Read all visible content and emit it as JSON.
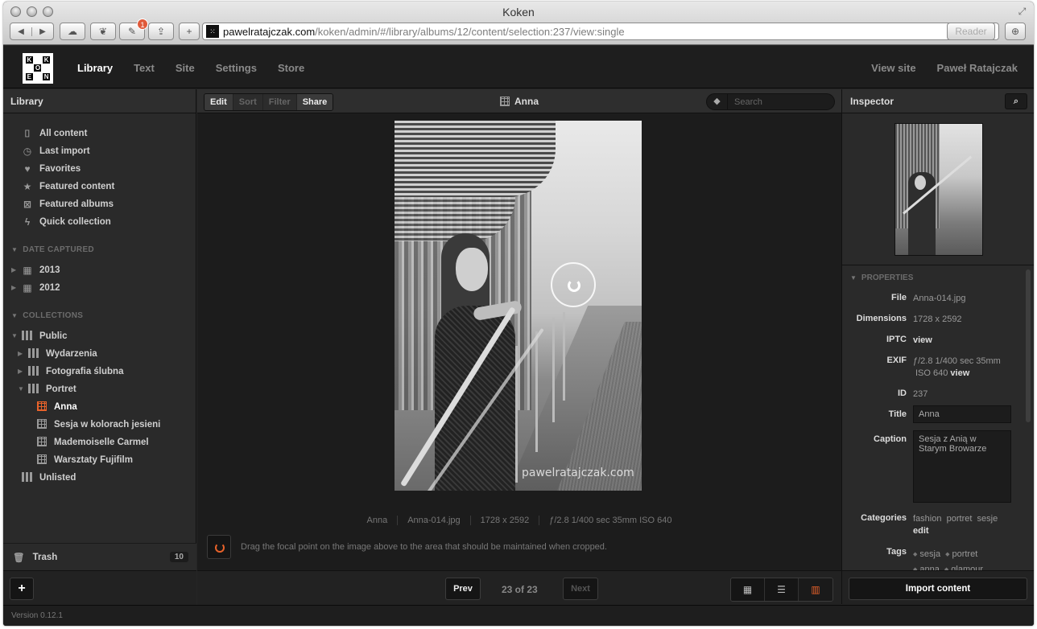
{
  "browser": {
    "title": "Koken",
    "url_host": "pawelratajczak.com",
    "url_path": "/koken/admin/#/library/albums/12/content/selection:237/view:single",
    "reader_label": "Reader",
    "notification_count": "1"
  },
  "header": {
    "logo_letters": [
      "K",
      "",
      "K",
      "",
      "O",
      "",
      "E",
      "",
      "N"
    ],
    "nav": [
      "Library",
      "Text",
      "Site",
      "Settings",
      "Store"
    ],
    "active_nav": "Library",
    "view_site": "View site",
    "user_name": "Paweł Ratajczak"
  },
  "sidebar": {
    "title": "Library",
    "quick_items": [
      {
        "label": "All content",
        "icon": "camera-icon"
      },
      {
        "label": "Last import",
        "icon": "clock-icon"
      },
      {
        "label": "Favorites",
        "icon": "heart-icon"
      },
      {
        "label": "Featured content",
        "icon": "star-icon"
      },
      {
        "label": "Featured albums",
        "icon": "featured-album-icon"
      },
      {
        "label": "Quick collection",
        "icon": "lightning-icon"
      }
    ],
    "date_section": "DATE CAPTURED",
    "years": [
      "2013",
      "2012"
    ],
    "collections_section": "COLLECTIONS",
    "collections": {
      "public": "Public",
      "wydarzenia": "Wydarzenia",
      "fotografia_slubna": "Fotografia ślubna",
      "portret": "Portret",
      "albums": [
        "Anna",
        "Sesja w kolorach jesieni",
        "Mademoiselle Carmel",
        "Warsztaty Fujifilm"
      ],
      "active_album": "Anna",
      "unlisted": "Unlisted"
    },
    "trash_label": "Trash",
    "trash_count": "10",
    "add_label": "+"
  },
  "center": {
    "actions": [
      "Edit",
      "Sort",
      "Filter",
      "Share"
    ],
    "album_title": "Anna",
    "search_placeholder": "Search",
    "watermark": "pawelratajczak.com",
    "meta": [
      "Anna",
      "Anna-014.jpg",
      "1728 x 2592",
      "ƒ/2.8  1/400 sec  35mm  ISO 640"
    ],
    "focal_hint": "Drag the focal point on the image above to the area that should be maintained when cropped.",
    "prev_label": "Prev",
    "next_label": "Next",
    "page_count": "23 of 23",
    "views": [
      "grid-view-icon",
      "list-view-icon",
      "filmstrip-view-icon"
    ],
    "accent_color": "#e8622a"
  },
  "inspector": {
    "title": "Inspector",
    "properties_head": "PROPERTIES",
    "file_label": "File",
    "file_value": "Anna-014.jpg",
    "dimensions_label": "Dimensions",
    "dimensions_value": "1728 x 2592",
    "iptc_label": "IPTC",
    "iptc_value": "view",
    "exif_label": "EXIF",
    "exif_line1": "ƒ/2.8  1/400 sec  35mm",
    "exif_line2": "ISO 640",
    "exif_view": "view",
    "id_label": "ID",
    "id_value": "237",
    "title_label": "Title",
    "title_value": "Anna",
    "caption_label": "Caption",
    "caption_value": "Sesja z Anią w Starym Browarze",
    "categories_label": "Categories",
    "categories": [
      "fashion",
      "portret",
      "sesje"
    ],
    "categories_edit": "edit",
    "tags_label": "Tags",
    "tags": [
      "sesja",
      "portret",
      "anna",
      "glamour"
    ],
    "import_label": "Import content"
  },
  "status": {
    "version": "Version 0.12.1"
  }
}
